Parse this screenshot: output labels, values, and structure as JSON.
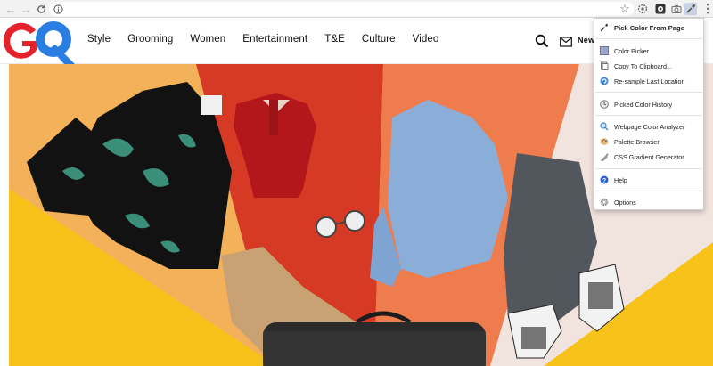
{
  "browser": {
    "toolbar_icons": [
      "back-arrow-icon",
      "forward-arrow-icon",
      "reload-icon",
      "info-icon",
      "bookmark-star-icon",
      "extension-icon",
      "extension-icon",
      "camera-icon",
      "eyedropper-extension-icon",
      "menu-dots-icon"
    ]
  },
  "site": {
    "logo_text": "GQ",
    "logo_color": "#e3222b",
    "logo_accent": "#2a7de1",
    "nav": [
      "Style",
      "Grooming",
      "Women",
      "Entertainment",
      "T&E",
      "Culture",
      "Video"
    ],
    "newsletter_label": "News"
  },
  "popup": {
    "items": [
      {
        "label": "Pick Color From Page",
        "icon": "eyedropper-icon",
        "bold": true
      },
      {
        "label": "Color Picker",
        "icon": "color-swatch-icon",
        "bold": false
      },
      {
        "label": "Copy To Clipboard...",
        "icon": "clipboard-icon",
        "bold": false
      },
      {
        "label": "Re-sample Last Location",
        "icon": "resample-icon",
        "bold": false
      },
      {
        "label": "Picked Color History",
        "icon": "history-icon",
        "bold": false
      },
      {
        "label": "Webpage Color Analyzer",
        "icon": "magnifier-icon",
        "bold": false
      },
      {
        "label": "Palette Browser",
        "icon": "palette-icon",
        "bold": false
      },
      {
        "label": "CSS Gradient Generator",
        "icon": "gradient-pen-icon",
        "bold": false
      },
      {
        "label": "Help",
        "icon": "help-icon",
        "bold": false
      },
      {
        "label": "Options",
        "icon": "gear-icon",
        "bold": false
      }
    ]
  }
}
